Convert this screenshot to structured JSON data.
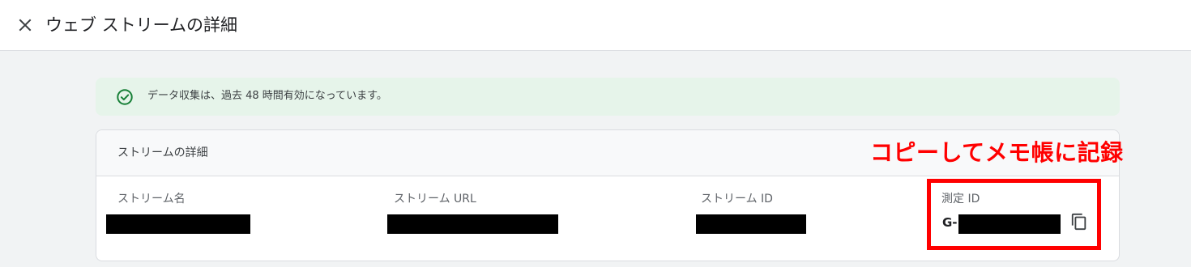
{
  "header": {
    "title": "ウェブ ストリームの詳細",
    "close_icon": "close-icon"
  },
  "banner": {
    "icon": "check-circle-icon",
    "text": "データ収集は、過去 48 時間有効になっています。",
    "color": "#188038"
  },
  "stream_details": {
    "title": "ストリームの詳細",
    "fields": [
      {
        "label": "ストリーム名",
        "value_redacted": true
      },
      {
        "label": "ストリーム URL",
        "value_redacted": true
      },
      {
        "label": "ストリーム ID",
        "value_redacted": true
      },
      {
        "label": "測定 ID",
        "value_prefix": "G-",
        "value_redacted": true,
        "copy_icon": "copy-icon"
      }
    ]
  },
  "annotation": {
    "text": "コピーしてメモ帳に記録",
    "color": "#ff0000"
  }
}
